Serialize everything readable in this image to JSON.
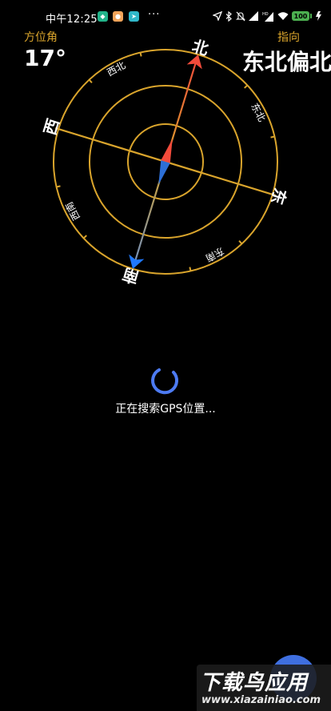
{
  "status_bar": {
    "time": "中午12:25",
    "more": "···",
    "battery": "100",
    "icons": [
      "location-arrow-icon",
      "bluetooth-icon",
      "mute-bell-icon",
      "signal-icon",
      "signal-hd-icon",
      "wifi-icon",
      "battery-icon",
      "charging-icon"
    ]
  },
  "header": {
    "azimuth_label": "方位角",
    "azimuth_value": "17°",
    "direction_label": "指向",
    "direction_value": "东北偏北"
  },
  "compass": {
    "heading_deg": 17,
    "cardinals": {
      "north": "北",
      "east": "东",
      "south": "南",
      "west": "西"
    },
    "intercardinals": {
      "ne": "东北",
      "se": "东南",
      "sw": "西南",
      "nw": "西北"
    },
    "colors": {
      "ring": "#d9a42c",
      "north": "#f24b3b",
      "south": "#1f78ff",
      "center_blue": "#2d6fd6"
    }
  },
  "status": {
    "gps_text": "正在搜索GPS位置..."
  },
  "watermark": {
    "title": "下载鸟应用",
    "url": "www.xiazainiao.com"
  }
}
